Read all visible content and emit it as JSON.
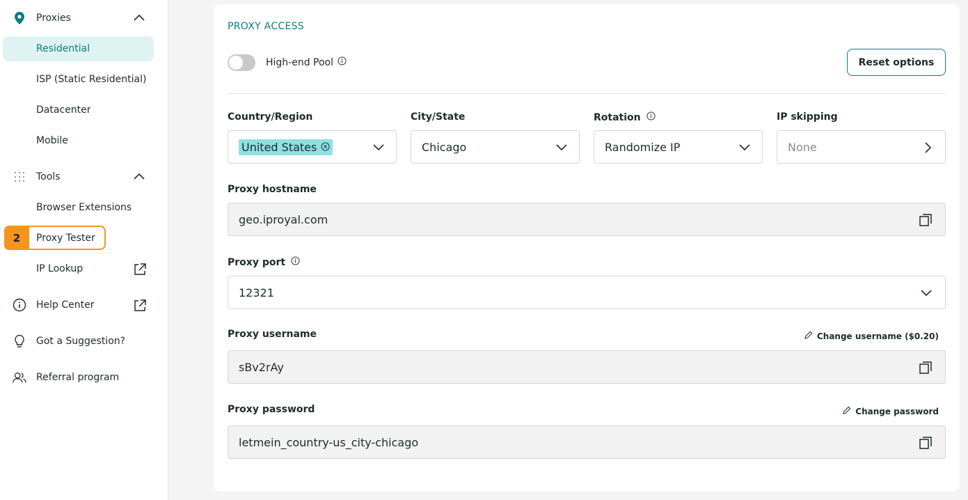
{
  "sidebar": {
    "proxies_label": "Proxies",
    "items": [
      {
        "label": "Residential"
      },
      {
        "label": "ISP (Static Residential)"
      },
      {
        "label": "Datacenter"
      },
      {
        "label": "Mobile"
      }
    ],
    "tools_label": "Tools",
    "tools": [
      {
        "label": "Browser Extensions"
      },
      {
        "label": "Proxy Tester"
      },
      {
        "label": "IP Lookup"
      }
    ],
    "badge": "2",
    "help_center": "Help Center",
    "suggestion": "Got a Suggestion?",
    "referral": "Referral program"
  },
  "main": {
    "section_title": "PROXY ACCESS",
    "high_end_pool_label": "High-end Pool",
    "reset_label": "Reset options",
    "country": {
      "label": "Country/Region",
      "value": "United States"
    },
    "city": {
      "label": "City/State",
      "value": "Chicago"
    },
    "rotation": {
      "label": "Rotation",
      "value": "Randomize IP"
    },
    "ip_skipping": {
      "label": "IP skipping",
      "value": "None"
    },
    "hostname": {
      "label": "Proxy hostname",
      "value": "geo.iproyal.com"
    },
    "port": {
      "label": "Proxy port",
      "value": "12321"
    },
    "username": {
      "label": "Proxy username",
      "value": "sBv2rAy",
      "change_label": "Change username ($0.20)"
    },
    "password": {
      "label": "Proxy password",
      "value": "letmein_country-us_city-chicago",
      "change_label": "Change password"
    }
  },
  "colors": {
    "accent": "#0e7c7b",
    "highlight": "#f7941d",
    "chip": "#8fe0e0"
  }
}
